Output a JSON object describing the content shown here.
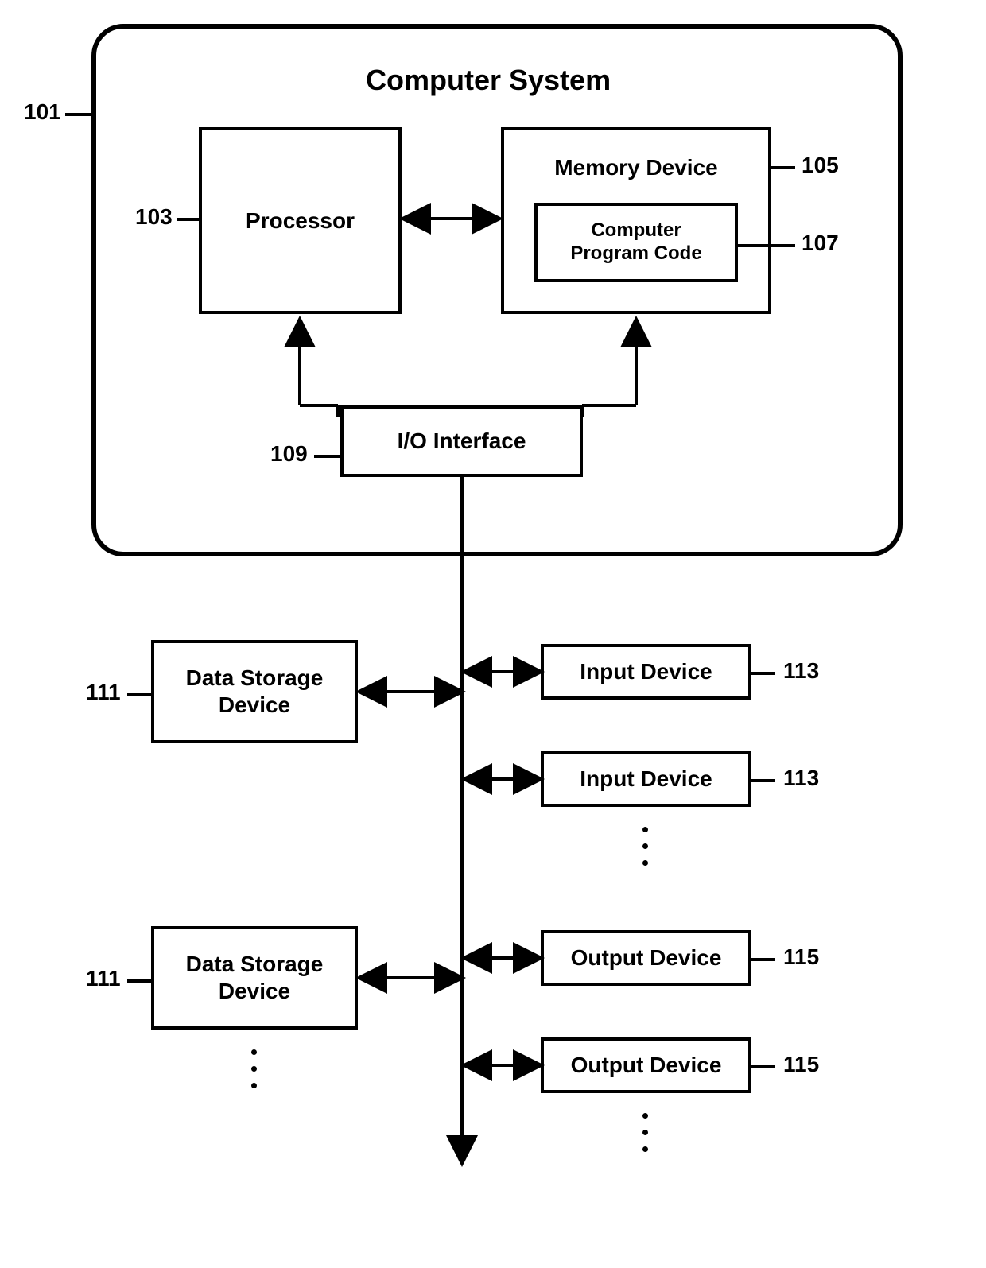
{
  "title": "Computer System",
  "blocks": {
    "processor": "Processor",
    "memory": "Memory Device",
    "program_code": "Computer\nProgram Code",
    "io": "I/O Interface",
    "data_storage": "Data Storage\nDevice",
    "input_device": "Input Device",
    "output_device": "Output Device"
  },
  "refs": {
    "r101": "101",
    "r103": "103",
    "r105": "105",
    "r107": "107",
    "r109": "109",
    "r111": "111",
    "r113": "113",
    "r115": "115"
  }
}
